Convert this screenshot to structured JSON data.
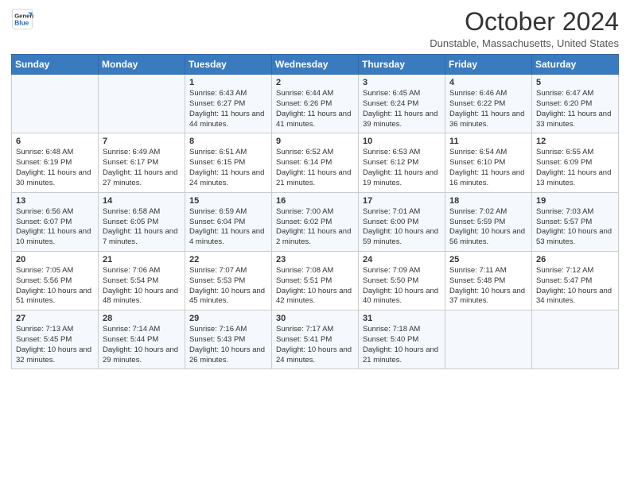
{
  "logo": {
    "line1": "General",
    "line2": "Blue"
  },
  "title": "October 2024",
  "location": "Dunstable, Massachusetts, United States",
  "days_of_week": [
    "Sunday",
    "Monday",
    "Tuesday",
    "Wednesday",
    "Thursday",
    "Friday",
    "Saturday"
  ],
  "weeks": [
    [
      {
        "day": "",
        "info": ""
      },
      {
        "day": "",
        "info": ""
      },
      {
        "day": "1",
        "info": "Sunrise: 6:43 AM\nSunset: 6:27 PM\nDaylight: 11 hours\nand 44 minutes."
      },
      {
        "day": "2",
        "info": "Sunrise: 6:44 AM\nSunset: 6:26 PM\nDaylight: 11 hours\nand 41 minutes."
      },
      {
        "day": "3",
        "info": "Sunrise: 6:45 AM\nSunset: 6:24 PM\nDaylight: 11 hours\nand 39 minutes."
      },
      {
        "day": "4",
        "info": "Sunrise: 6:46 AM\nSunset: 6:22 PM\nDaylight: 11 hours\nand 36 minutes."
      },
      {
        "day": "5",
        "info": "Sunrise: 6:47 AM\nSunset: 6:20 PM\nDaylight: 11 hours\nand 33 minutes."
      }
    ],
    [
      {
        "day": "6",
        "info": "Sunrise: 6:48 AM\nSunset: 6:19 PM\nDaylight: 11 hours\nand 30 minutes."
      },
      {
        "day": "7",
        "info": "Sunrise: 6:49 AM\nSunset: 6:17 PM\nDaylight: 11 hours\nand 27 minutes."
      },
      {
        "day": "8",
        "info": "Sunrise: 6:51 AM\nSunset: 6:15 PM\nDaylight: 11 hours\nand 24 minutes."
      },
      {
        "day": "9",
        "info": "Sunrise: 6:52 AM\nSunset: 6:14 PM\nDaylight: 11 hours\nand 21 minutes."
      },
      {
        "day": "10",
        "info": "Sunrise: 6:53 AM\nSunset: 6:12 PM\nDaylight: 11 hours\nand 19 minutes."
      },
      {
        "day": "11",
        "info": "Sunrise: 6:54 AM\nSunset: 6:10 PM\nDaylight: 11 hours\nand 16 minutes."
      },
      {
        "day": "12",
        "info": "Sunrise: 6:55 AM\nSunset: 6:09 PM\nDaylight: 11 hours\nand 13 minutes."
      }
    ],
    [
      {
        "day": "13",
        "info": "Sunrise: 6:56 AM\nSunset: 6:07 PM\nDaylight: 11 hours\nand 10 minutes."
      },
      {
        "day": "14",
        "info": "Sunrise: 6:58 AM\nSunset: 6:05 PM\nDaylight: 11 hours\nand 7 minutes."
      },
      {
        "day": "15",
        "info": "Sunrise: 6:59 AM\nSunset: 6:04 PM\nDaylight: 11 hours\nand 4 minutes."
      },
      {
        "day": "16",
        "info": "Sunrise: 7:00 AM\nSunset: 6:02 PM\nDaylight: 11 hours\nand 2 minutes."
      },
      {
        "day": "17",
        "info": "Sunrise: 7:01 AM\nSunset: 6:00 PM\nDaylight: 10 hours\nand 59 minutes."
      },
      {
        "day": "18",
        "info": "Sunrise: 7:02 AM\nSunset: 5:59 PM\nDaylight: 10 hours\nand 56 minutes."
      },
      {
        "day": "19",
        "info": "Sunrise: 7:03 AM\nSunset: 5:57 PM\nDaylight: 10 hours\nand 53 minutes."
      }
    ],
    [
      {
        "day": "20",
        "info": "Sunrise: 7:05 AM\nSunset: 5:56 PM\nDaylight: 10 hours\nand 51 minutes."
      },
      {
        "day": "21",
        "info": "Sunrise: 7:06 AM\nSunset: 5:54 PM\nDaylight: 10 hours\nand 48 minutes."
      },
      {
        "day": "22",
        "info": "Sunrise: 7:07 AM\nSunset: 5:53 PM\nDaylight: 10 hours\nand 45 minutes."
      },
      {
        "day": "23",
        "info": "Sunrise: 7:08 AM\nSunset: 5:51 PM\nDaylight: 10 hours\nand 42 minutes."
      },
      {
        "day": "24",
        "info": "Sunrise: 7:09 AM\nSunset: 5:50 PM\nDaylight: 10 hours\nand 40 minutes."
      },
      {
        "day": "25",
        "info": "Sunrise: 7:11 AM\nSunset: 5:48 PM\nDaylight: 10 hours\nand 37 minutes."
      },
      {
        "day": "26",
        "info": "Sunrise: 7:12 AM\nSunset: 5:47 PM\nDaylight: 10 hours\nand 34 minutes."
      }
    ],
    [
      {
        "day": "27",
        "info": "Sunrise: 7:13 AM\nSunset: 5:45 PM\nDaylight: 10 hours\nand 32 minutes."
      },
      {
        "day": "28",
        "info": "Sunrise: 7:14 AM\nSunset: 5:44 PM\nDaylight: 10 hours\nand 29 minutes."
      },
      {
        "day": "29",
        "info": "Sunrise: 7:16 AM\nSunset: 5:43 PM\nDaylight: 10 hours\nand 26 minutes."
      },
      {
        "day": "30",
        "info": "Sunrise: 7:17 AM\nSunset: 5:41 PM\nDaylight: 10 hours\nand 24 minutes."
      },
      {
        "day": "31",
        "info": "Sunrise: 7:18 AM\nSunset: 5:40 PM\nDaylight: 10 hours\nand 21 minutes."
      },
      {
        "day": "",
        "info": ""
      },
      {
        "day": "",
        "info": ""
      }
    ]
  ]
}
